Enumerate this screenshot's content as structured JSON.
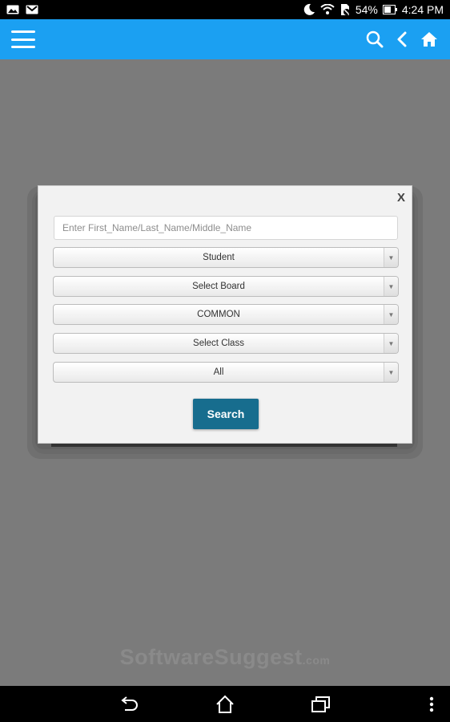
{
  "status_bar": {
    "battery": "54%",
    "time": "4:24 PM",
    "icons": [
      "image-notification-icon",
      "gmail-icon",
      "moon-icon",
      "wifi-icon",
      "sim-blocked-icon",
      "battery-icon"
    ]
  },
  "app_bar": {
    "color": "#1ba0f2",
    "icons": [
      "menu-icon",
      "search-icon",
      "back-icon",
      "home-icon"
    ]
  },
  "modal": {
    "close_label": "X",
    "name_placeholder": "Enter First_Name/Last_Name/Middle_Name",
    "selects": [
      "Student",
      "Select Board",
      "COMMON",
      "Select Class",
      "All"
    ],
    "search_label": "Search",
    "search_color": "#176d8e"
  },
  "watermark": {
    "main": "SoftwareSuggest",
    "suffix": ".com"
  },
  "nav_bar": {
    "icons": [
      "back-nav-icon",
      "home-nav-icon",
      "recents-nav-icon",
      "overflow-menu-icon"
    ]
  }
}
